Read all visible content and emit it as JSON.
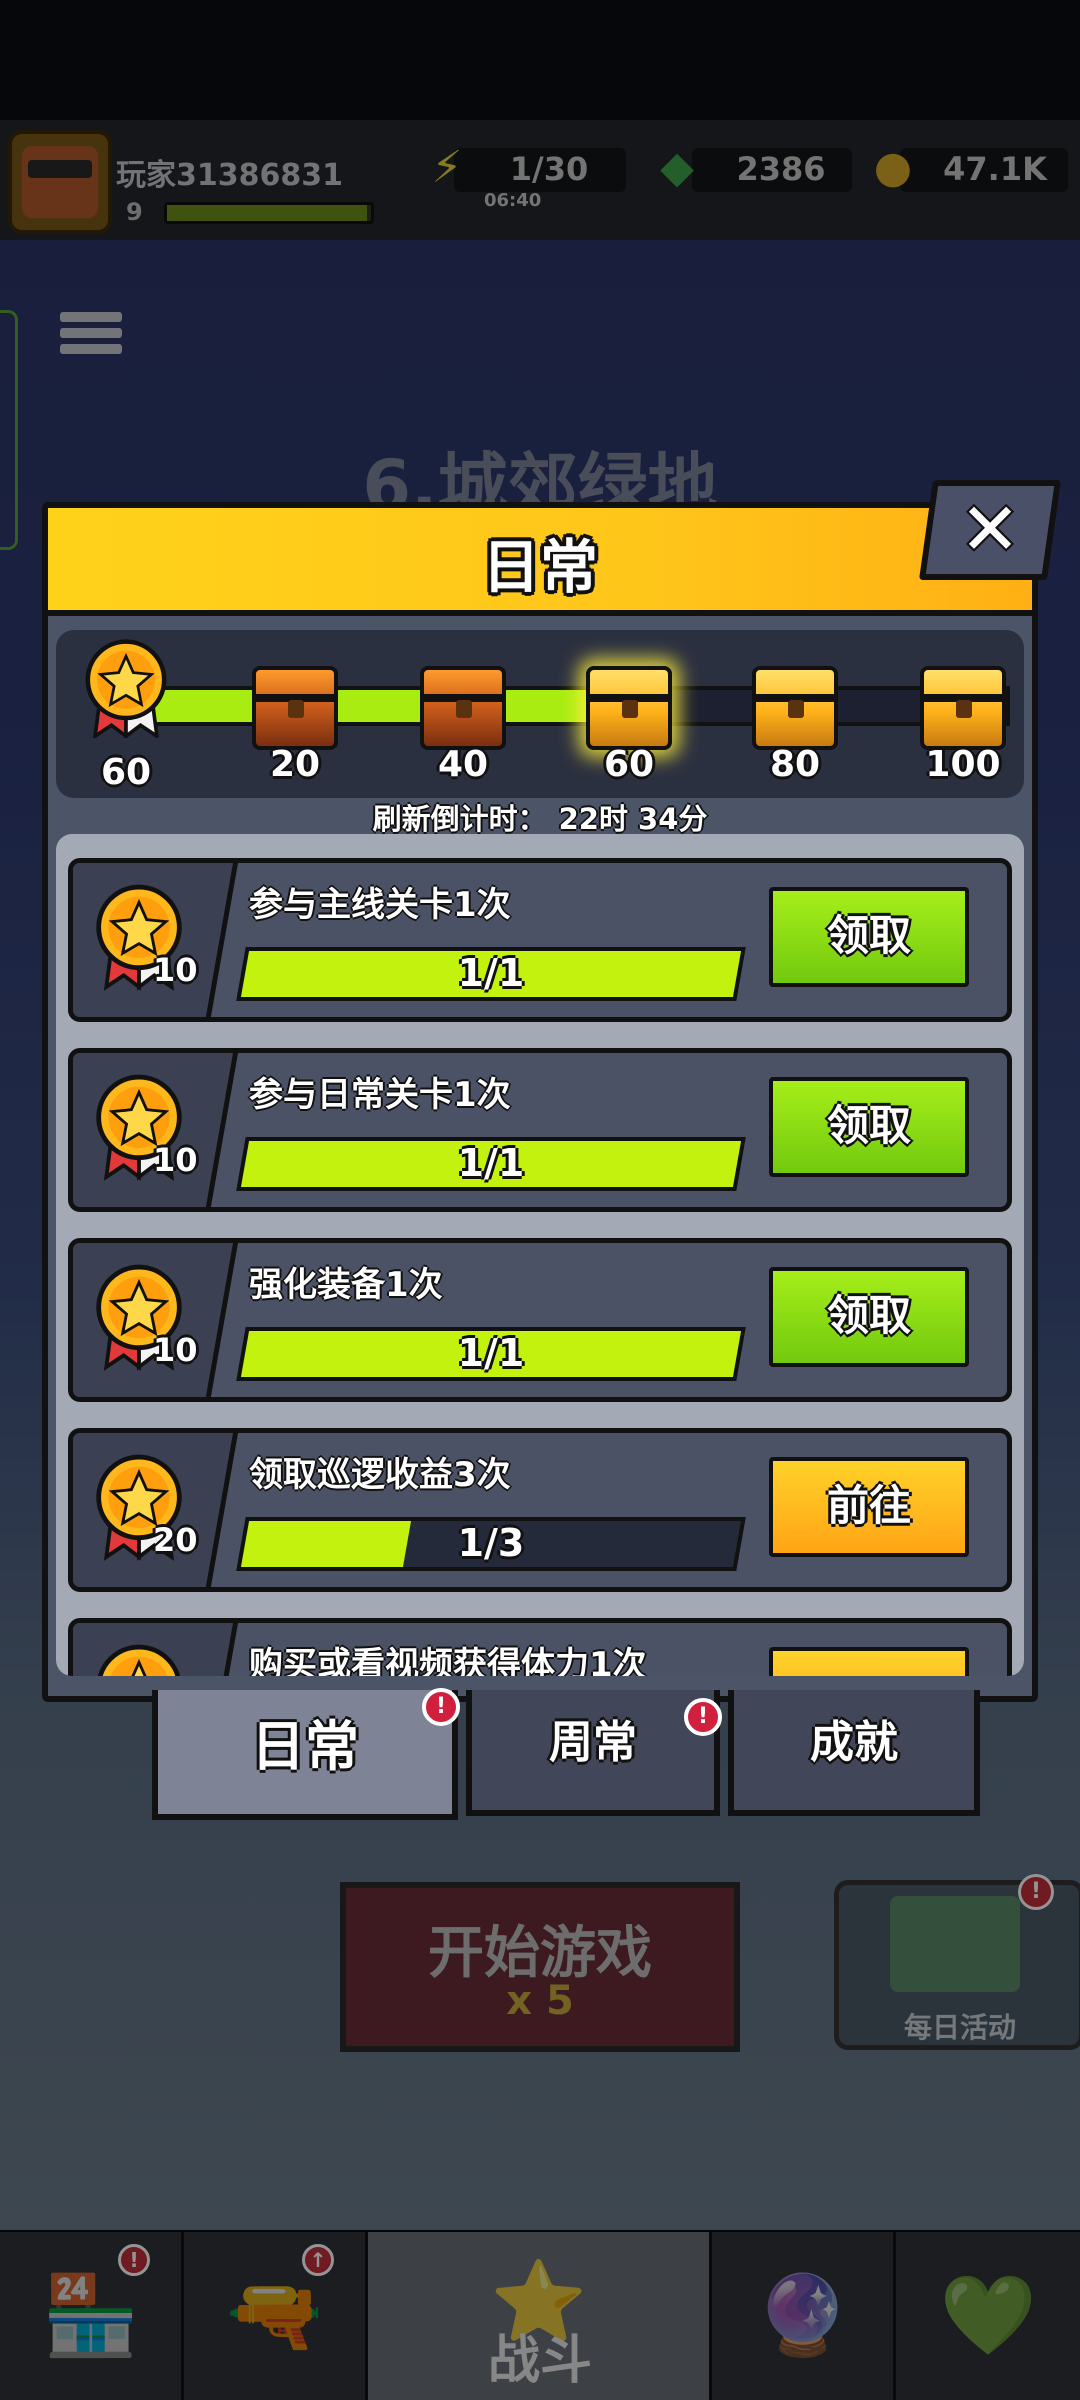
{
  "hud": {
    "player_name": "玩家31386831",
    "player_level": "9",
    "energy": "1/30",
    "energy_timer": "06:40",
    "gems": "2386",
    "coins": "47.1K",
    "energy_icon": "lightning-icon",
    "gems_icon": "gem-icon",
    "coins_icon": "coin-icon"
  },
  "background": {
    "stage_title": "6.城郊绿地",
    "start_button": "开始游戏",
    "start_cost": "x 5",
    "daily_activity": "每日活动"
  },
  "modal": {
    "title": "日常",
    "close_icon": "close-icon",
    "track": {
      "current_points": "60",
      "progress_fraction": 0.55,
      "milestones": [
        {
          "label": "20",
          "chest": "brown",
          "state": "claimed"
        },
        {
          "label": "40",
          "chest": "brown",
          "state": "claimed"
        },
        {
          "label": "60",
          "chest": "gold",
          "state": "ready"
        },
        {
          "label": "80",
          "chest": "gold",
          "state": "locked"
        },
        {
          "label": "100",
          "chest": "gold",
          "state": "locked"
        }
      ]
    },
    "refresh_label": "刷新倒计时：",
    "refresh_value": "22时 34分",
    "tasks": [
      {
        "title": "参与主线关卡1次",
        "points": "10",
        "progress": "1/1",
        "progress_fraction": 1.0,
        "button": "领取",
        "button_type": "claim"
      },
      {
        "title": "参与日常关卡1次",
        "points": "10",
        "progress": "1/1",
        "progress_fraction": 1.0,
        "button": "领取",
        "button_type": "claim"
      },
      {
        "title": "强化装备1次",
        "points": "10",
        "progress": "1/1",
        "progress_fraction": 1.0,
        "button": "领取",
        "button_type": "claim"
      },
      {
        "title": "领取巡逻收益3次",
        "points": "20",
        "progress": "1/3",
        "progress_fraction": 0.333,
        "button": "前往",
        "button_type": "go"
      },
      {
        "title": "购买或看视频获得体力1次",
        "points": "",
        "progress": "",
        "progress_fraction": 0,
        "button": "",
        "button_type": "go"
      }
    ]
  },
  "tabs": [
    {
      "label": "日常",
      "active": true,
      "badge": "!"
    },
    {
      "label": "周常",
      "active": false,
      "badge": "!"
    },
    {
      "label": "成就",
      "active": false,
      "badge": ""
    }
  ],
  "bottom_nav": {
    "items": [
      "shop-icon",
      "weapon-icon",
      "battle-icon",
      "talent-icon",
      "gear-icon"
    ],
    "battle_label": "战斗",
    "badges": [
      "!",
      "↑",
      "",
      "",
      ""
    ],
    "active_index": 2
  },
  "colors": {
    "header_yellow": "#ffd21a",
    "progress_green": "#c3f20e",
    "claim_green": "#7fd60e",
    "go_orange": "#ffb014",
    "badge_red": "#d11f3e"
  }
}
